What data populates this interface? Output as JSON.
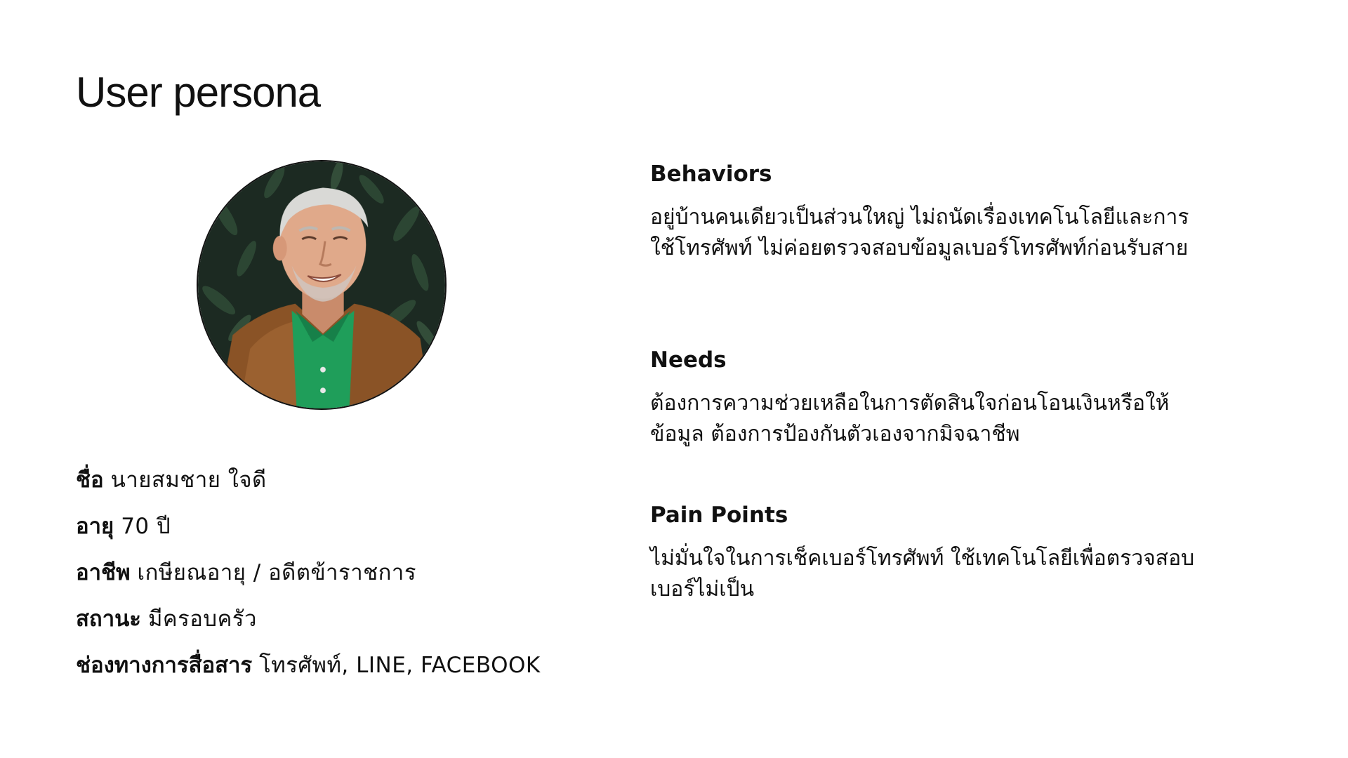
{
  "page": {
    "title": "User persona"
  },
  "persona": {
    "avatar_icon": "elderly-man-portrait",
    "fields": [
      {
        "label": "ชื่อ",
        "value": "นายสมชาย ใจดี"
      },
      {
        "label": "อายุ",
        "value": "70 ปี"
      },
      {
        "label": "อาชีพ",
        "value": "เกษียณอายุ / อดีตข้าราชการ"
      },
      {
        "label": "สถานะ",
        "value": "มีครอบครัว"
      },
      {
        "label": "ช่องทางการสื่อสาร",
        "value": "โทรศัพท์, LINE, FACEBOOK"
      }
    ]
  },
  "sections": {
    "behaviors": {
      "heading": "Behaviors",
      "text": "อยู่บ้านคนเดียวเป็นส่วนใหญ่ ไม่ถนัดเรื่องเทคโนโลยีและการใช้โทรศัพท์ ไม่ค่อยตรวจสอบข้อมูลเบอร์โทรศัพท์ก่อนรับสาย"
    },
    "needs": {
      "heading": "Needs",
      "text": "ต้องการความช่วยเหลือในการตัดสินใจก่อนโอนเงินหรือให้ข้อมูล ต้องการป้องกันตัวเองจากมิจฉาชีพ"
    },
    "pain_points": {
      "heading": "Pain Points",
      "text": "ไม่มั่นใจในการเช็คเบอร์โทรศัพท์ ใช้เทคโนโลยีเพื่อตรวจสอบเบอร์ไม่เป็น"
    }
  }
}
